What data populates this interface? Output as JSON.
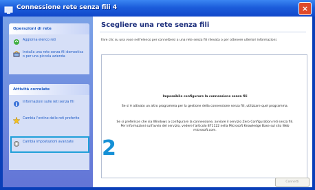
{
  "window": {
    "title": "Connessione rete senza fili 4",
    "close_label": "×"
  },
  "sidebar": {
    "network_tasks": {
      "title": "Operazioni di rete",
      "items": [
        {
          "label": "Aggiorna elenco reti",
          "icon": "refresh-icon"
        },
        {
          "label": "Installa una rete senza fili domestica o per una piccola azienda",
          "icon": "setup-network-icon"
        }
      ]
    },
    "related_tasks": {
      "title": "Attività correlate",
      "items": [
        {
          "label": "Informazioni sulle reti senza fili",
          "icon": "info-icon"
        },
        {
          "label": "Cambia l'ordine delle reti preferite",
          "icon": "star-icon"
        },
        {
          "label": "Cambia impostazioni avanzate",
          "icon": "settings-icon"
        }
      ]
    }
  },
  "main": {
    "heading": "Scegliere una rete senza fili",
    "intro": "Fare clic su una voce nell'elenco per connettersi a una rete senza fili rilevata o per ottenere ulteriori informazioni.",
    "message_title": "Impossibile configurare la connessione senza fili",
    "message_1": "Se si è attivato un altro programma per la gestione della connessione senza fili, utilizzare quel programma.",
    "message_2": "Se si preferisce che sia Windows a configurare la connessione, avviare il servizio Zero Configuration reti senza fili. Per informazioni sull'avvio del servizio, vedere l'articolo 871122 nella Microsoft Knowledge Base sul sito Web microsoft.com.",
    "connect_label": "Connetti"
  },
  "annotation": {
    "step": "2",
    "color": "#1590d6"
  }
}
